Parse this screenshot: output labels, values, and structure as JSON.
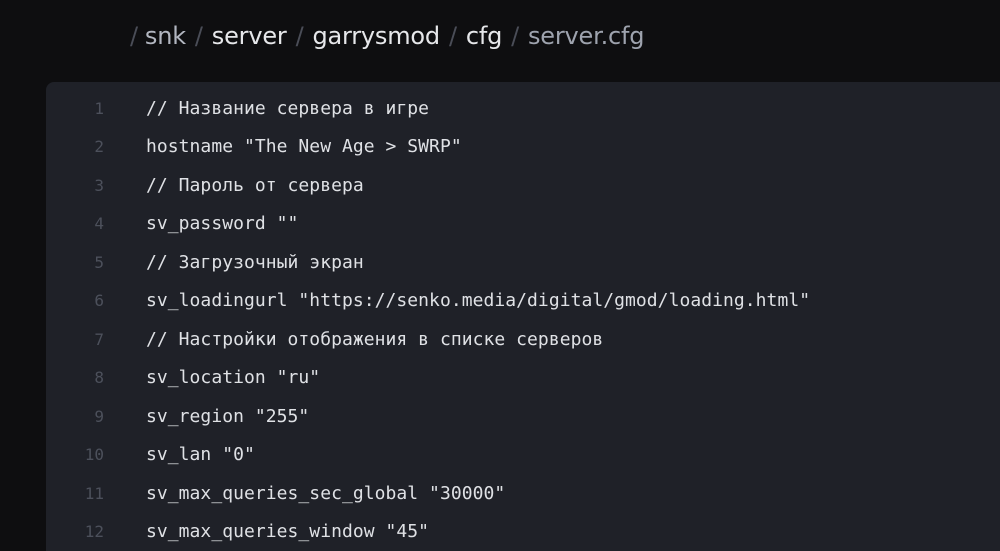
{
  "breadcrumb": {
    "separator": "/",
    "items": [
      {
        "label": "snk",
        "kind": "dim"
      },
      {
        "label": "server",
        "kind": "link"
      },
      {
        "label": "garrysmod",
        "kind": "link"
      },
      {
        "label": "cfg",
        "kind": "link"
      },
      {
        "label": "server.cfg",
        "kind": "current"
      }
    ]
  },
  "code": {
    "lines": [
      {
        "number": "1",
        "text": "// Название сервера в игре"
      },
      {
        "number": "2",
        "text": "hostname \"The New Age > SWRP\""
      },
      {
        "number": "3",
        "text": "// Пароль от сервера"
      },
      {
        "number": "4",
        "text": "sv_password \"\""
      },
      {
        "number": "5",
        "text": "// Загрузочный экран"
      },
      {
        "number": "6",
        "text": "sv_loadingurl \"https://senko.media/digital/gmod/loading.html\""
      },
      {
        "number": "7",
        "text": "// Настройки отображения в списке серверов"
      },
      {
        "number": "8",
        "text": "sv_location \"ru\""
      },
      {
        "number": "9",
        "text": "sv_region \"255\""
      },
      {
        "number": "10",
        "text": "sv_lan \"0\""
      },
      {
        "number": "11",
        "text": "sv_max_queries_sec_global \"30000\""
      },
      {
        "number": "12",
        "text": "sv_max_queries_window \"45\""
      }
    ]
  },
  "colors": {
    "page_background": "#0e0e10",
    "code_background": "#1f2128",
    "code_text": "#dfe1e5",
    "line_number": "#4c505b"
  }
}
